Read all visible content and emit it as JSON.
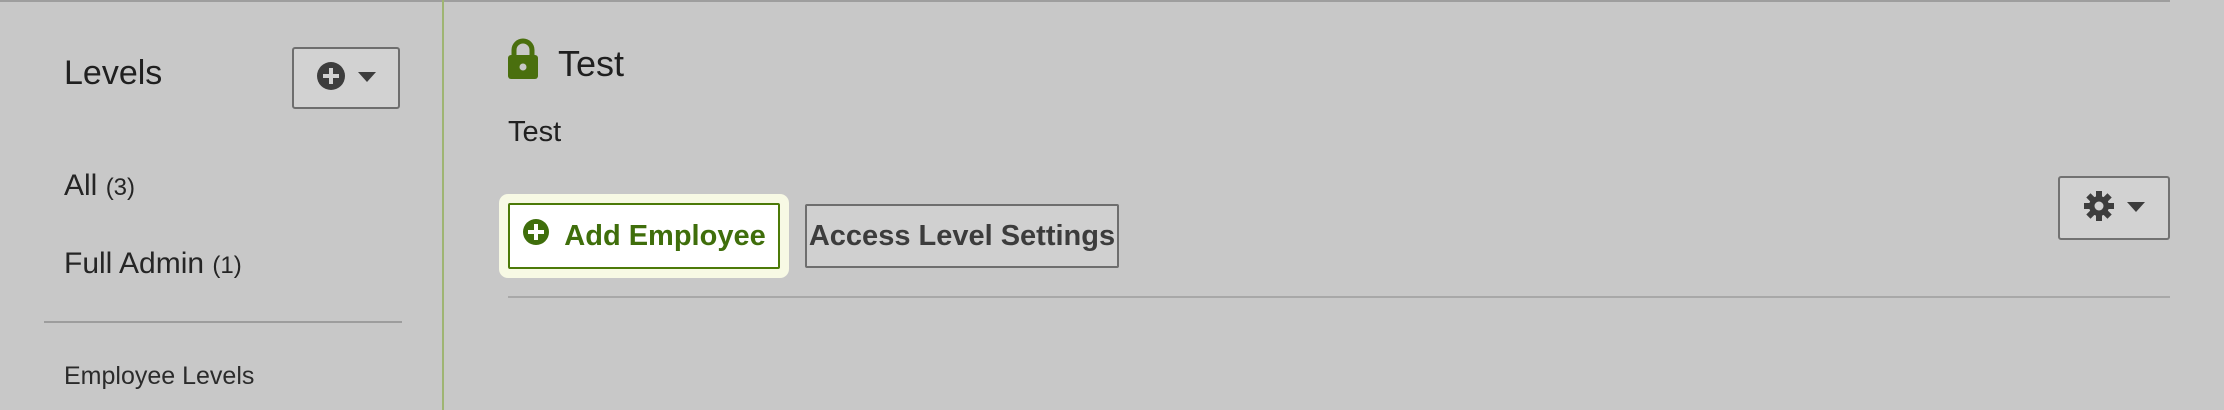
{
  "sidebar": {
    "title": "Levels",
    "add_button_icons": [
      "plus-circle-icon",
      "caret-down-icon"
    ],
    "items": [
      {
        "label": "All",
        "count": "(3)"
      },
      {
        "label": "Full Admin",
        "count": "(1)"
      }
    ],
    "section_label": "Employee Levels"
  },
  "main": {
    "title_icon": "lock-icon",
    "title": "Test",
    "description": "Test",
    "add_employee_label": "Add Employee",
    "access_settings_label": "Access Level Settings",
    "settings_icons": [
      "gear-icon",
      "caret-down-icon"
    ]
  },
  "colors": {
    "accent_green": "#3f6e0b",
    "lock_green": "#4a6f0e",
    "background": "#c8c8c8",
    "focus_ring": "#f7f9e4"
  }
}
